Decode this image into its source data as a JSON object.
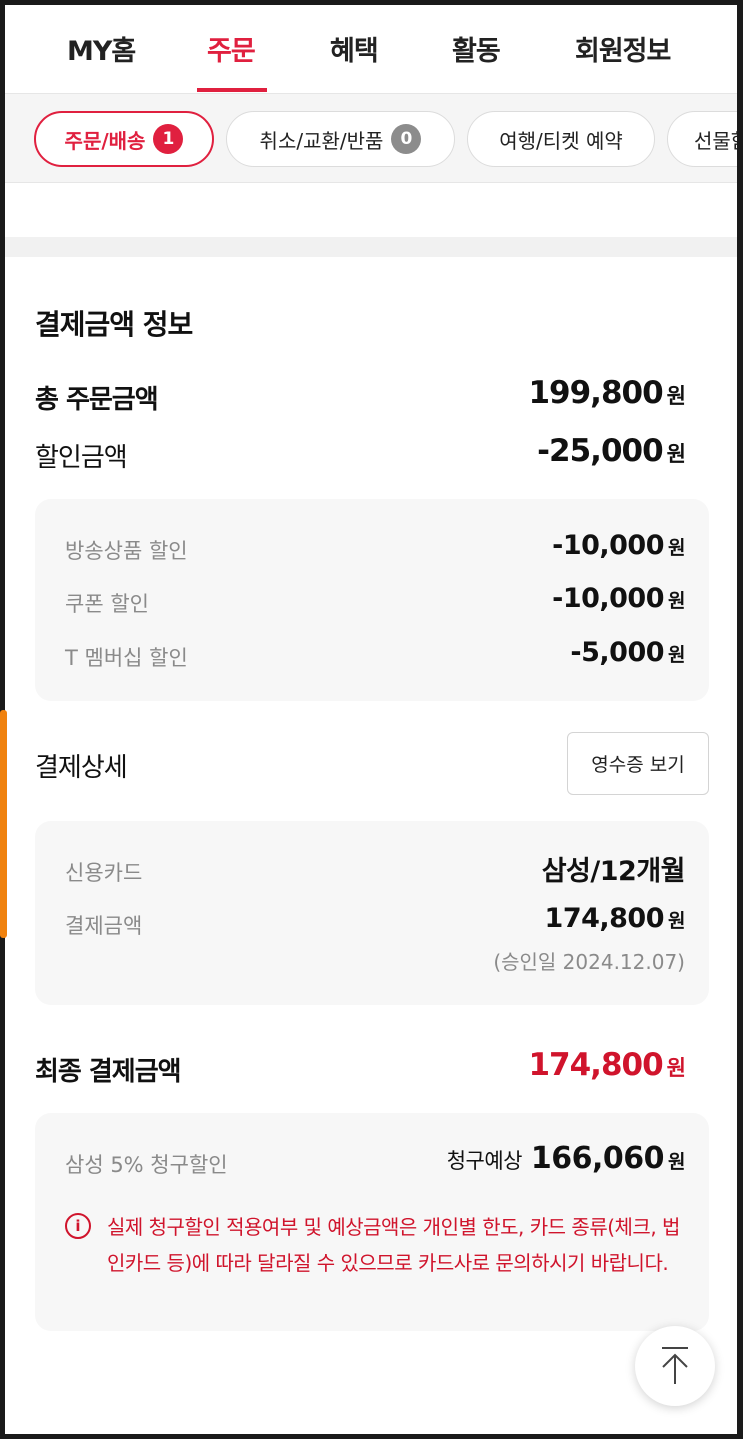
{
  "topnav": {
    "tabs": [
      {
        "label": "MY홈"
      },
      {
        "label": "주문"
      },
      {
        "label": "혜택"
      },
      {
        "label": "활동"
      },
      {
        "label": "회원정보"
      }
    ],
    "active_index": 1
  },
  "chips": [
    {
      "label": "주문/배송",
      "count": "1"
    },
    {
      "label": "취소/교환/반품",
      "count": "0"
    },
    {
      "label": "여행/티켓 예약"
    },
    {
      "label": "선물함"
    }
  ],
  "payment": {
    "title": "결제금액 정보",
    "total": {
      "label": "총 주문금액",
      "amount": "199,800",
      "unit": "원"
    },
    "discount": {
      "label": "할인금액",
      "amount": "-25,000",
      "unit": "원"
    },
    "discount_items": [
      {
        "label": "방송상품 할인",
        "amount": "-10,000",
        "unit": "원"
      },
      {
        "label": "쿠폰 할인",
        "amount": "-10,000",
        "unit": "원"
      },
      {
        "label": "T 멤버십 할인",
        "amount": "-5,000",
        "unit": "원"
      }
    ]
  },
  "detail": {
    "title": "결제상세",
    "receipt_button": "영수증 보기",
    "card_label": "신용카드",
    "card_value": "삼성/12개월",
    "paid_label": "결제금액",
    "paid_amount": "174,800",
    "paid_unit": "원",
    "approval": "(승인일 2024.12.07)"
  },
  "final": {
    "label": "최종 결제금액",
    "amount": "174,800",
    "unit": "원",
    "billing_label": "삼성 5% 청구할인",
    "expected_prefix": "청구예상",
    "expected_amount": "166,060",
    "expected_unit": "원",
    "notice": "실제 청구할인 적용여부 및 예상금액은 개인별 한도, 카드 종류(체크, 법인카드 등)에 따라 달라질 수 있으므로 카드사로 문의하시기 바랍니다."
  },
  "colors": {
    "accent": "#e0203f",
    "price_red": "#d0142c",
    "scroll_indicator": "#f0820f"
  },
  "icons": [
    "info-icon",
    "arrow-up-icon"
  ]
}
